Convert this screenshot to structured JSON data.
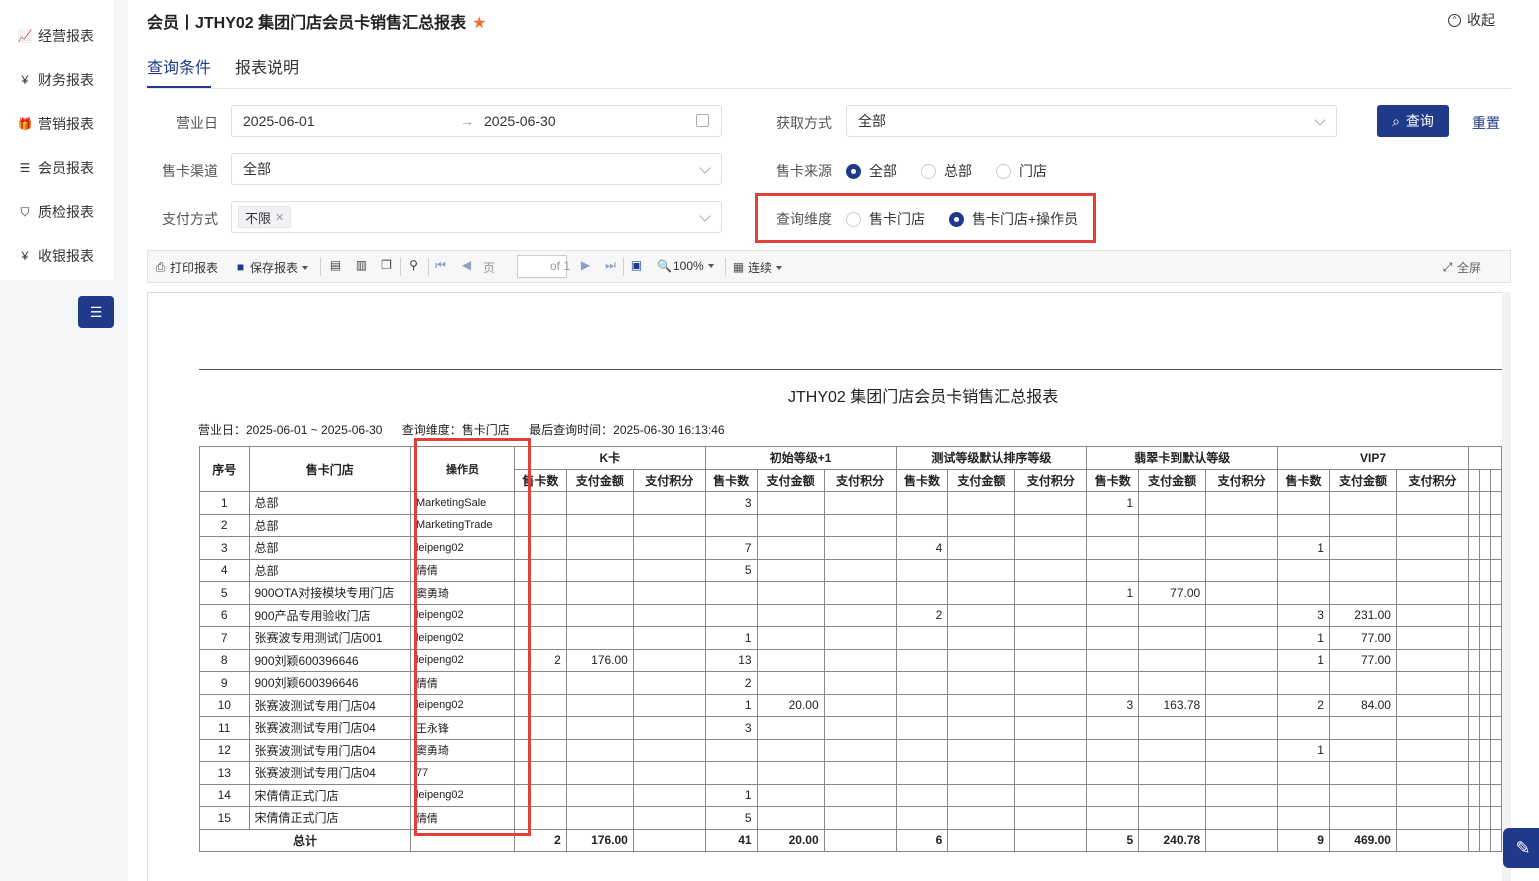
{
  "sidebar": {
    "items": [
      {
        "label": "经营报表",
        "icon": "line-chart-icon",
        "glyph": "📈"
      },
      {
        "label": "财务报表",
        "icon": "finance-icon",
        "glyph": "¥"
      },
      {
        "label": "营销报表",
        "icon": "gift-icon",
        "glyph": "🎁"
      },
      {
        "label": "会员报表",
        "icon": "member-doc-icon",
        "glyph": "☰"
      },
      {
        "label": "质检报表",
        "icon": "shield-icon",
        "glyph": "⛉"
      },
      {
        "label": "收银报表",
        "icon": "cashier-icon",
        "glyph": "¥"
      }
    ]
  },
  "header": {
    "title": "会员丨JTHY02 集团门店会员卡销售汇总报表",
    "star": "★",
    "collapse_label": "收起"
  },
  "tabs": [
    {
      "label": "查询条件",
      "active": true
    },
    {
      "label": "报表说明",
      "active": false
    }
  ],
  "form": {
    "business_day_label": "营业日",
    "date_start": "2025-06-01",
    "date_arrow": "→",
    "date_end": "2025-06-30",
    "acquire_label": "获取方式",
    "acquire_value": "全部",
    "channel_label": "售卡渠道",
    "channel_value": "全部",
    "source_label": "售卡来源",
    "source_options": [
      "全部",
      "总部",
      "门店"
    ],
    "source_selected": 0,
    "payment_label": "支付方式",
    "payment_tag": "不限",
    "dimension_label": "查询维度",
    "dimension_options": [
      "售卡门店",
      "售卡门店+操作员"
    ],
    "dimension_selected": 1,
    "query_button": "查询",
    "reset_button": "重置"
  },
  "toolbar": {
    "print": "打印报表",
    "save": "保存报表",
    "page_label": "页",
    "of_label": "of 1",
    "zoom": "100%",
    "mode": "连续",
    "fullscreen": "全屏"
  },
  "report": {
    "title": "JTHY02 集团门店会员卡销售汇总报表",
    "info_day": "营业日：2025-06-01 ~ 2025-06-30",
    "info_dim": "查询维度：售卡门店",
    "info_time": "最后查询时间：2025-06-30 16:13:46",
    "col_no": "序号",
    "col_store": "售卡门店",
    "col_operator": "操作员",
    "groups": [
      "K卡",
      "初始等级+1",
      "测试等级默认排序等级",
      "翡翠卡到默认等级",
      "VIP7"
    ],
    "sub_headers": [
      "售卡数",
      "支付金额",
      "支付积分"
    ],
    "rows": [
      {
        "no": "1",
        "store": "总部",
        "op": "MarketingSale",
        "v": [
          "",
          "",
          "",
          "3",
          "",
          "",
          "",
          "",
          "",
          "1",
          "",
          "",
          "",
          "",
          ""
        ]
      },
      {
        "no": "2",
        "store": "总部",
        "op": "MarketingTrade",
        "v": [
          "",
          "",
          "",
          "",
          "",
          "",
          "",
          "",
          "",
          "",
          "",
          "",
          "",
          "",
          ""
        ]
      },
      {
        "no": "3",
        "store": "总部",
        "op": "leipeng02",
        "v": [
          "",
          "",
          "",
          "7",
          "",
          "",
          "4",
          "",
          "",
          "",
          "",
          "",
          "1",
          "",
          ""
        ]
      },
      {
        "no": "4",
        "store": "总部",
        "op": "倩倩",
        "v": [
          "",
          "",
          "",
          "5",
          "",
          "",
          "",
          "",
          "",
          "",
          "",
          "",
          "",
          "",
          ""
        ]
      },
      {
        "no": "5",
        "store": "900OTA对接模块专用门店",
        "op": "窦勇琦",
        "v": [
          "",
          "",
          "",
          "",
          "",
          "",
          "",
          "",
          "",
          "1",
          "77.00",
          "",
          "",
          "",
          ""
        ]
      },
      {
        "no": "6",
        "store": "900产品专用验收门店",
        "op": "leipeng02",
        "v": [
          "",
          "",
          "",
          "",
          "",
          "",
          "2",
          "",
          "",
          "",
          "",
          "",
          "3",
          "231.00",
          ""
        ]
      },
      {
        "no": "7",
        "store": "张赛波专用测试门店001",
        "op": "leipeng02",
        "v": [
          "",
          "",
          "",
          "1",
          "",
          "",
          "",
          "",
          "",
          "",
          "",
          "",
          "1",
          "77.00",
          ""
        ]
      },
      {
        "no": "8",
        "store": "900刘颖600396646",
        "op": "leipeng02",
        "v": [
          "2",
          "176.00",
          "",
          "13",
          "",
          "",
          "",
          "",
          "",
          "",
          "",
          "",
          "1",
          "77.00",
          ""
        ]
      },
      {
        "no": "9",
        "store": "900刘颖600396646",
        "op": "倩倩",
        "v": [
          "",
          "",
          "",
          "2",
          "",
          "",
          "",
          "",
          "",
          "",
          "",
          "",
          "",
          "",
          ""
        ]
      },
      {
        "no": "10",
        "store": "张赛波测试专用门店04",
        "op": "leipeng02",
        "v": [
          "",
          "",
          "",
          "1",
          "20.00",
          "",
          "",
          "",
          "",
          "3",
          "163.78",
          "",
          "2",
          "84.00",
          ""
        ]
      },
      {
        "no": "11",
        "store": "张赛波测试专用门店04",
        "op": "王永锋",
        "v": [
          "",
          "",
          "",
          "3",
          "",
          "",
          "",
          "",
          "",
          "",
          "",
          "",
          "",
          "",
          ""
        ]
      },
      {
        "no": "12",
        "store": "张赛波测试专用门店04",
        "op": "窦勇琦",
        "v": [
          "",
          "",
          "",
          "",
          "",
          "",
          "",
          "",
          "",
          "",
          "",
          "",
          "1",
          "",
          ""
        ]
      },
      {
        "no": "13",
        "store": "张赛波测试专用门店04",
        "op": "77",
        "v": [
          "",
          "",
          "",
          "",
          "",
          "",
          "",
          "",
          "",
          "",
          "",
          "",
          "",
          "",
          ""
        ]
      },
      {
        "no": "14",
        "store": "宋倩倩正式门店",
        "op": "leipeng02",
        "v": [
          "",
          "",
          "",
          "1",
          "",
          "",
          "",
          "",
          "",
          "",
          "",
          "",
          "",
          "",
          ""
        ]
      },
      {
        "no": "15",
        "store": "宋倩倩正式门店",
        "op": "倩倩",
        "v": [
          "",
          "",
          "",
          "5",
          "",
          "",
          "",
          "",
          "",
          "",
          "",
          "",
          "",
          "",
          ""
        ]
      }
    ],
    "total_label": "总计",
    "totals": [
      "2",
      "176.00",
      "",
      "41",
      "20.00",
      "",
      "6",
      "",
      "",
      "5",
      "240.78",
      "",
      "9",
      "469.00",
      ""
    ]
  },
  "colors": {
    "accent": "#1f3a8a",
    "highlight": "#e0403a",
    "star": "#f56c2e"
  }
}
